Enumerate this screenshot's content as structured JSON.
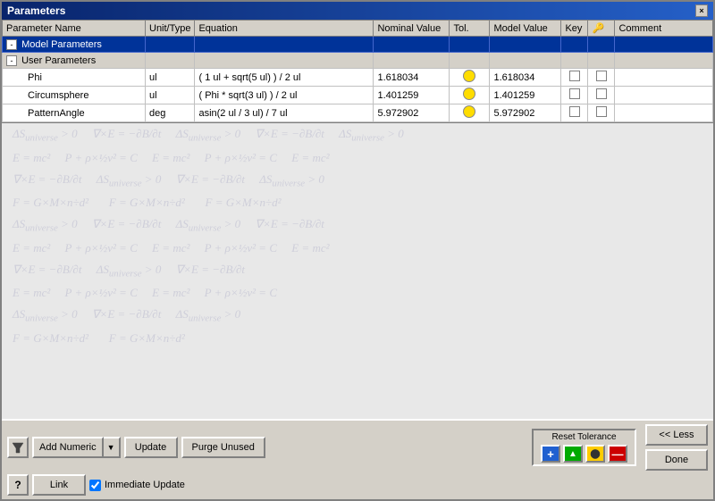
{
  "window": {
    "title": "Parameters",
    "close_label": "×"
  },
  "table": {
    "headers": [
      "Parameter Name",
      "Unit/Type",
      "Equation",
      "Nominal Value",
      "Tol.",
      "Model Value",
      "Key",
      "🔑",
      "Comment"
    ],
    "model_row": {
      "label": "Model Parameters",
      "indent": 1
    },
    "user_row": {
      "label": "User Parameters",
      "indent": 1
    },
    "params": [
      {
        "name": "Phi",
        "unit": "ul",
        "equation": "( 1 ul + sqrt(5 ul) ) / 2 ul",
        "nominal": "1.618034",
        "tol": "yellow",
        "model_value": "1.618034"
      },
      {
        "name": "Circumsphere",
        "unit": "ul",
        "equation": "( Phi * sqrt(3 ul) ) / 2 ul",
        "nominal": "1.401259",
        "tol": "yellow",
        "model_value": "1.401259"
      },
      {
        "name": "PatternAngle",
        "unit": "deg",
        "equation": "asin(2 ul / 3 ul) / 7 ul",
        "nominal": "5.972902",
        "tol": "yellow",
        "model_value": "5.972902"
      }
    ]
  },
  "math_rows": [
    "ΔSuniverse > 0    ∇×E = −∂B/∂t    ΔSuniverse > 0    ∇×E = −∂B/∂t    ΔSuniverse > 0",
    "E = mc²    P + ρ×½v² = C    E = mc²    P + ρ×½v² = C    E = mc²",
    "∇×E = −∂B/∂t    ΔSuniverse > 0    ∇×E = −∂B/∂t    ΔSuniverse > 0",
    "F = G×M×n÷d²    F = G×M×n÷d²    F = G×M×n÷d²",
    "ΔSuniverse > 0    ∇×E = −∂B/∂t    ΔSuniverse > 0    ∇×E = −∂B/∂t",
    "E = mc²    P + ρ×½v² = C    E = mc²    P + ρ×½v² = C    E = mc²",
    "∇×E = −∂B/∂t    ΔSuniverse > 0    ∇×E = −∂B/∂t",
    "E = mc²    P + ρ×½v² = C    E = mc²    P + ρ×½v² = C"
  ],
  "toolbar": {
    "filter_icon": "⊳",
    "add_numeric_label": "Add Numeric",
    "dropdown_arrow": "▼",
    "update_label": "Update",
    "purge_unused_label": "Purge Unused",
    "help_label": "?",
    "link_label": "Link",
    "immediate_update_label": "Immediate Update",
    "reset_tolerance_label": "Reset Tolerance",
    "tol_plus": "+",
    "tol_triangle": "▲",
    "tol_circle": "●",
    "tol_minus": "—",
    "less_label": "<< Less",
    "done_label": "Done"
  }
}
